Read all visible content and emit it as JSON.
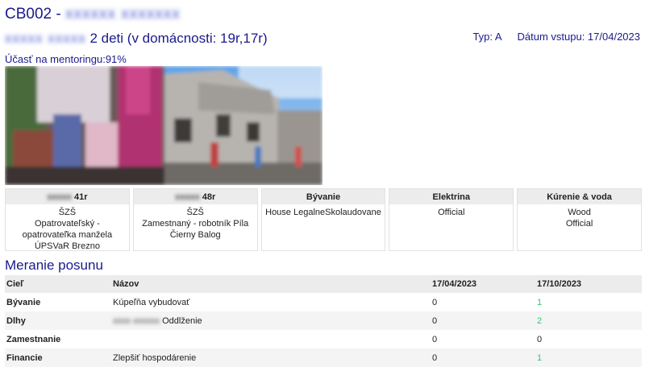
{
  "header": {
    "code": "CB002 -",
    "name_redacted": "xxxxxx xxxxxxx",
    "family_redacted": "xxxxx xxxxx",
    "children": "2 deti (v domácnosti: 19r,17r)",
    "type": "Typ: A",
    "entry_date": "Dátum vstupu: 17/04/2023",
    "mentoring": "Účasť na mentoringu:91%"
  },
  "cards": [
    {
      "name_redacted": "xxxxx",
      "title_suffix": " 41r",
      "body": "ŠZŠ\nOpatrovateľský - opatrovateľka manžela\nÚPSVaR Brezno"
    },
    {
      "name_redacted": "xxxxx",
      "title_suffix": " 48r",
      "body": "ŠZŠ\nZamestnaný - robotník Píla Čierny Balog"
    },
    {
      "title": "Bývanie",
      "body": "House LegalneSkolaudovane"
    },
    {
      "title": "Elektrina",
      "body": "Official"
    },
    {
      "title": "Kúrenie & voda",
      "body": "Wood\nOfficial"
    }
  ],
  "section_title": "Meranie posunu",
  "table": {
    "headers": [
      "Cieľ",
      "Názov",
      "17/04/2023",
      "17/10/2023"
    ],
    "rows": [
      {
        "goal": "Bývanie",
        "name": "Kúpeľňa vybudovať",
        "v1": "0",
        "v2": "1"
      },
      {
        "goal": "Dlhy",
        "name_redacted": "xxxx xxxxxx",
        "name": "Oddlženie",
        "v1": "0",
        "v2": "2"
      },
      {
        "goal": "Zamestnanie",
        "name": "",
        "v1": "0",
        "v2": "0"
      },
      {
        "goal": "Financie",
        "name": "Zlepšiť hospodárenie",
        "v1": "0",
        "v2": "1"
      }
    ]
  },
  "colors": {
    "heading": "#1a1a8c",
    "positive": "#3cc07a",
    "header_bg": "#ececec"
  }
}
